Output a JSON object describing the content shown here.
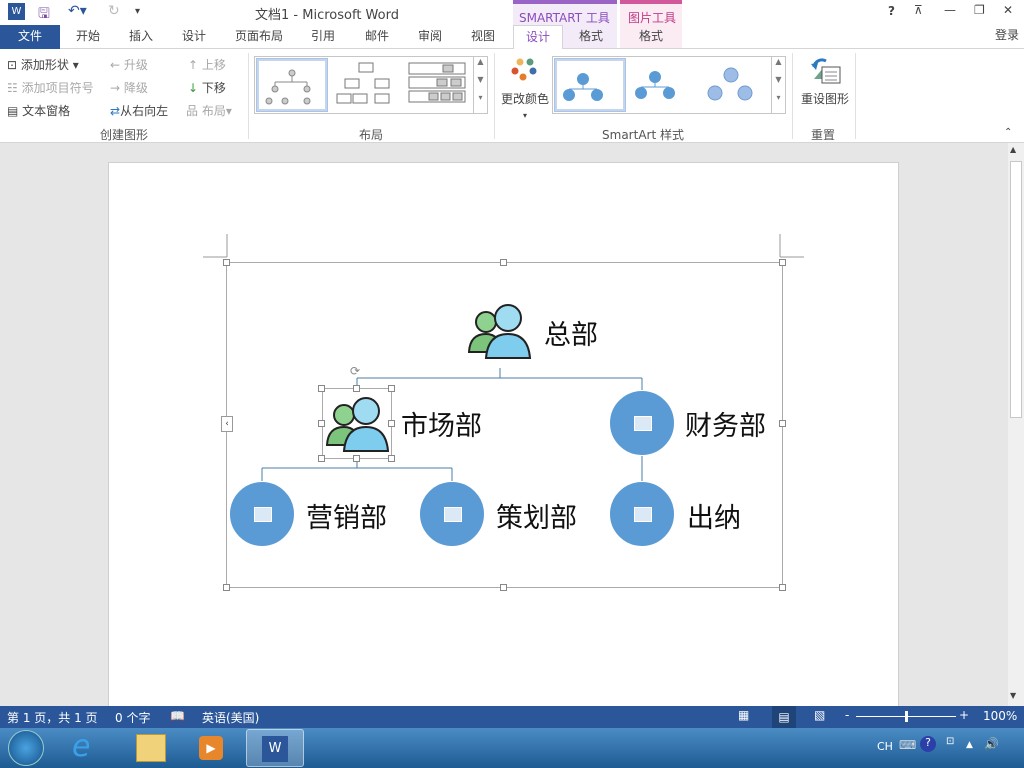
{
  "title": "文档1 - Microsoft Word",
  "window_controls": {
    "help": "?",
    "restore_ribbon": "⊼",
    "minimize": "—",
    "maximize": "❐",
    "close": "✕",
    "login": "登录"
  },
  "tabs": [
    {
      "label": "文件"
    },
    {
      "label": "开始"
    },
    {
      "label": "插入"
    },
    {
      "label": "设计"
    },
    {
      "label": "页面布局"
    },
    {
      "label": "引用"
    },
    {
      "label": "邮件"
    },
    {
      "label": "审阅"
    },
    {
      "label": "视图"
    },
    {
      "label": "设计"
    },
    {
      "label": "格式"
    },
    {
      "label": "格式"
    }
  ],
  "context_tabs": {
    "smartart": "SMARTART 工具",
    "picture": "图片工具"
  },
  "ribbon": {
    "create": {
      "add_shape": "添加形状",
      "add_bullet": "添加项目符号",
      "text_pane": "文本窗格",
      "promote": "升级",
      "demote": "降级",
      "rtl": "从右向左",
      "move_up": "上移",
      "move_down": "下移",
      "layout": "布局",
      "group": "创建图形"
    },
    "layouts": {
      "group": "布局"
    },
    "styles": {
      "change_colors": "更改颜色",
      "group": "SmartArt 样式"
    },
    "reset": {
      "reset_graphic": "重设图形",
      "group": "重置"
    }
  },
  "smartart": {
    "root": "总部",
    "market": "市场部",
    "finance": "财务部",
    "sales": "营销部",
    "planning": "策划部",
    "cashier": "出纳"
  },
  "status": {
    "page": "第 1 页，共 1 页",
    "words": "0 个字",
    "language": "英语(美国)",
    "zoom": "100%",
    "zoom_fraction": 0.5
  },
  "taskbar": {
    "ime": "CH"
  },
  "colors": {
    "accent": "#2b579a",
    "node": "#5b9bd5",
    "smartart_ctx": "#9a63c6",
    "picture_ctx": "#d2589c"
  }
}
